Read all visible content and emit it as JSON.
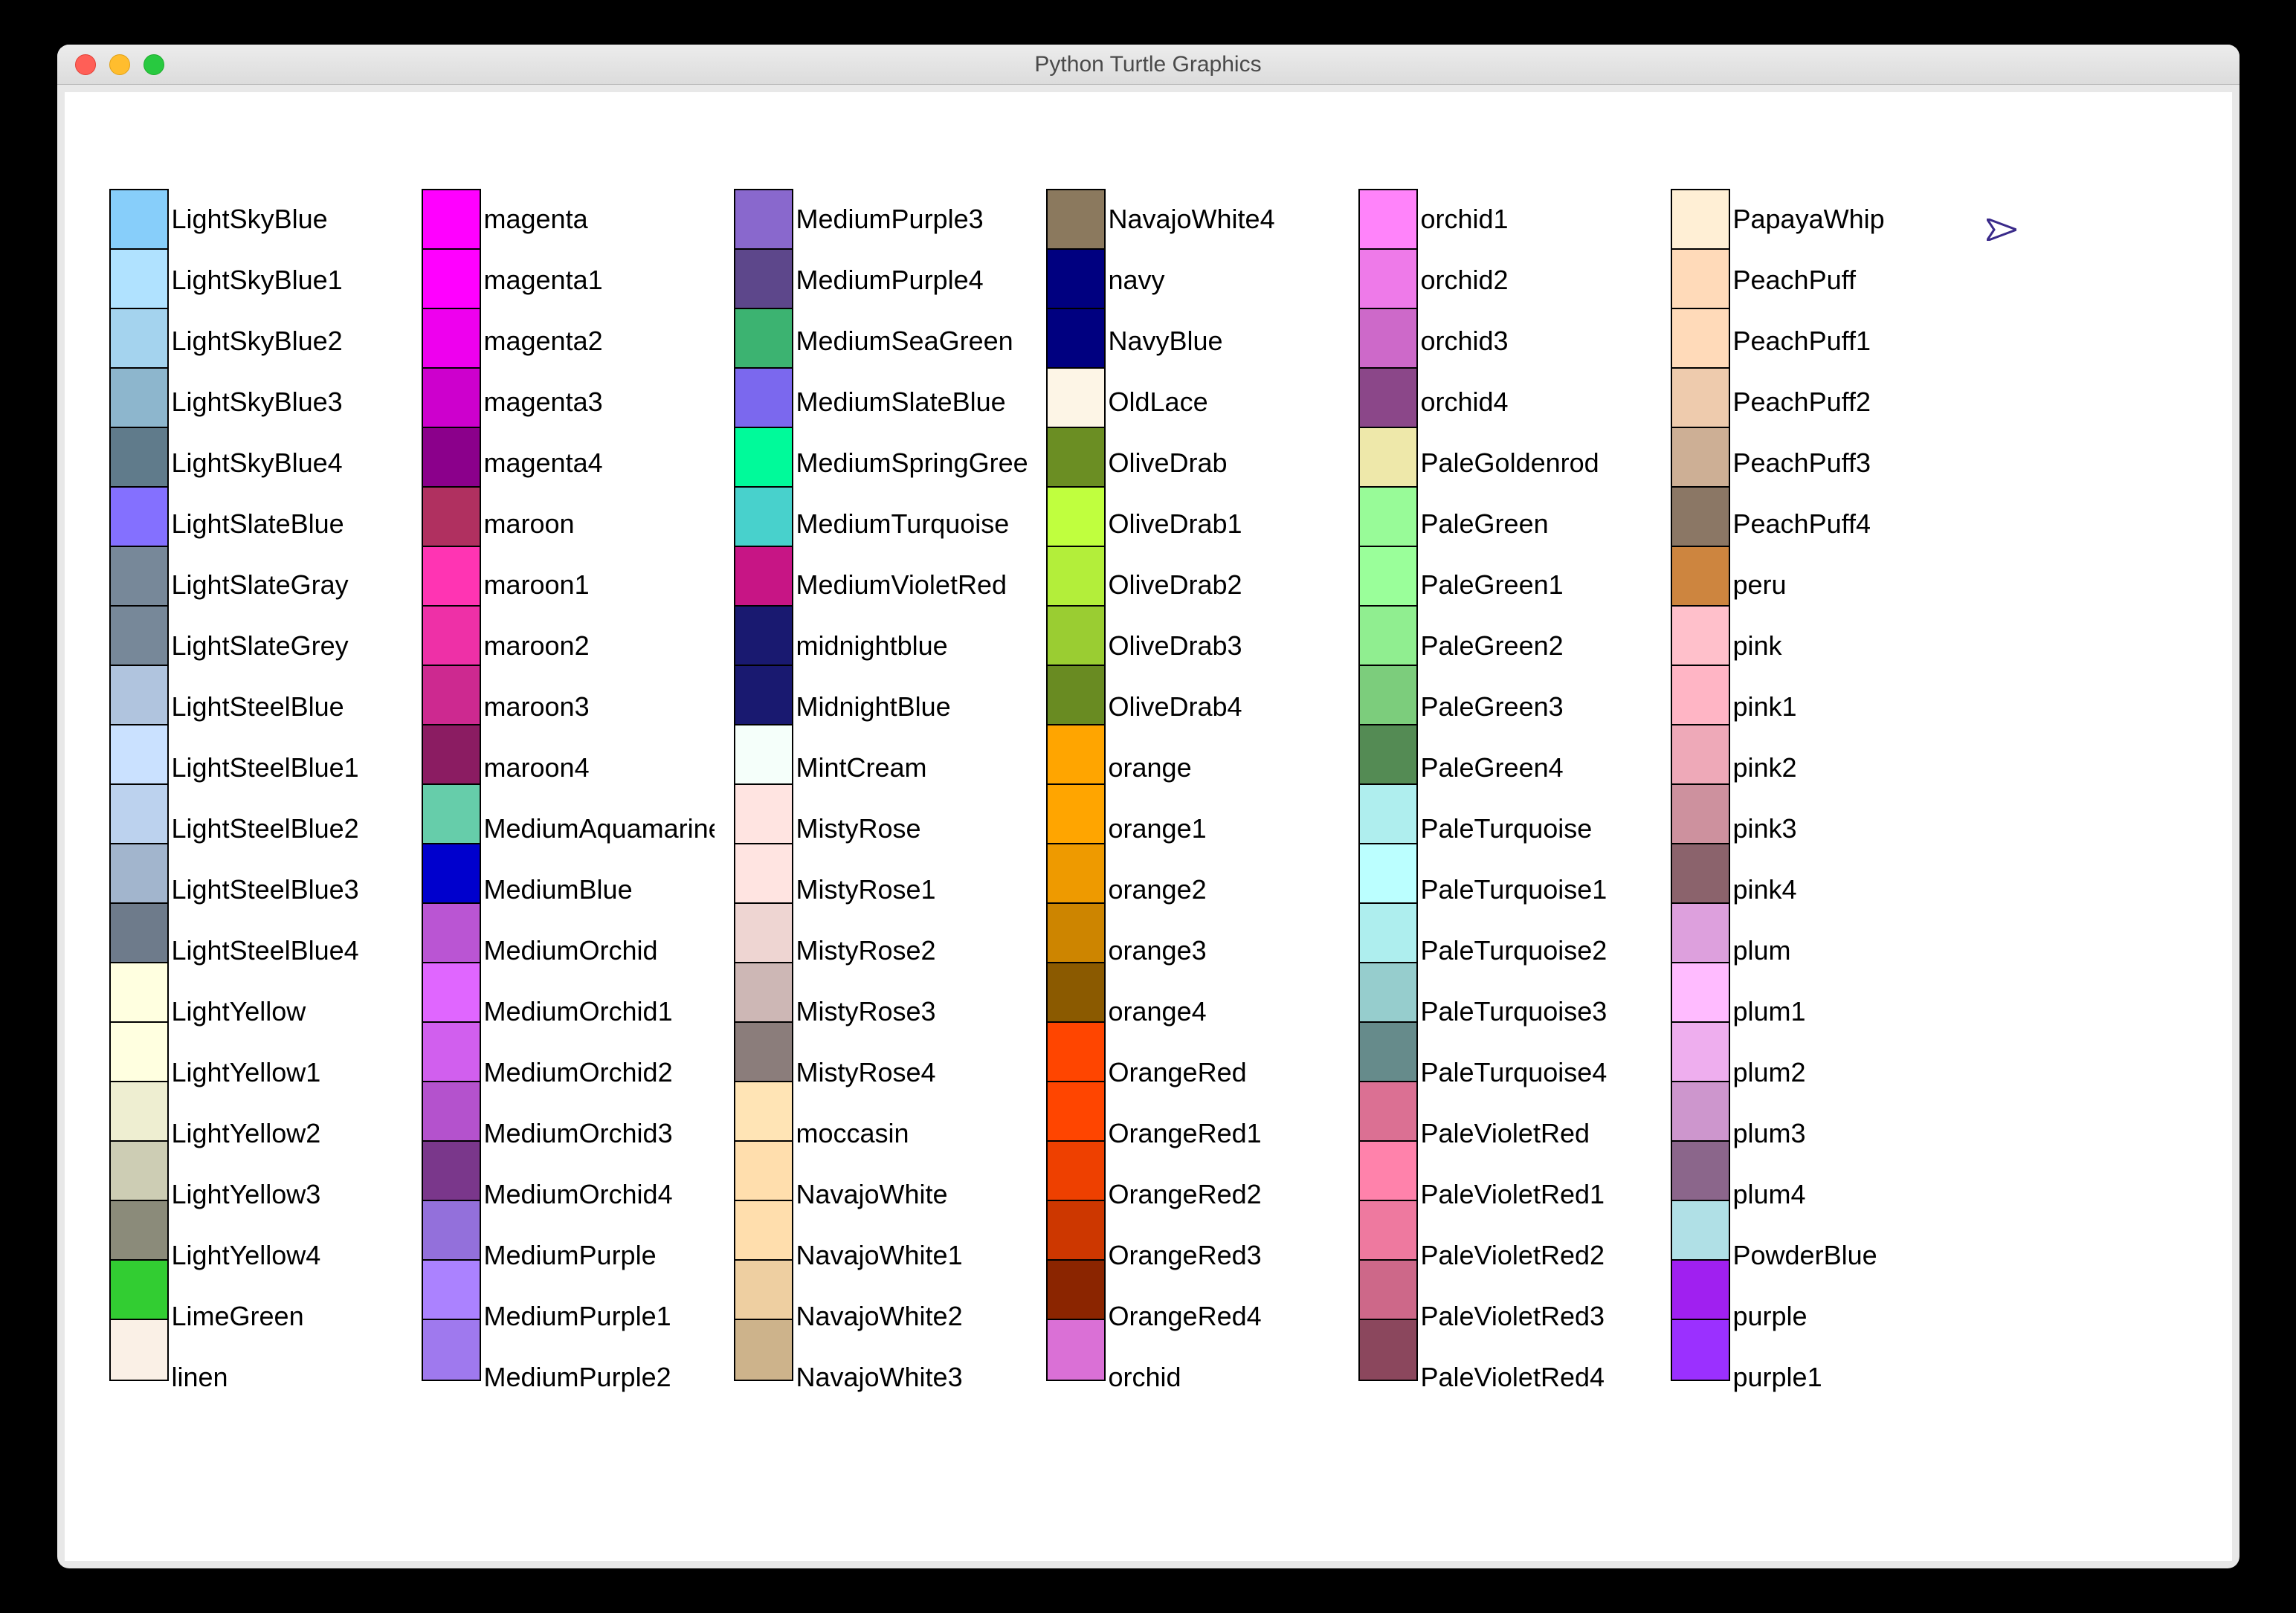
{
  "window": {
    "title": "Python Turtle Graphics"
  },
  "columns": [
    [
      {
        "name": "LightSkyBlue",
        "hex": "#87CEFA"
      },
      {
        "name": "LightSkyBlue1",
        "hex": "#B0E2FF"
      },
      {
        "name": "LightSkyBlue2",
        "hex": "#A4D3EE"
      },
      {
        "name": "LightSkyBlue3",
        "hex": "#8DB6CD"
      },
      {
        "name": "LightSkyBlue4",
        "hex": "#607B8B"
      },
      {
        "name": "LightSlateBlue",
        "hex": "#8470FF"
      },
      {
        "name": "LightSlateGray",
        "hex": "#778899"
      },
      {
        "name": "LightSlateGrey",
        "hex": "#778899"
      },
      {
        "name": "LightSteelBlue",
        "hex": "#B0C4DE"
      },
      {
        "name": "LightSteelBlue1",
        "hex": "#CAE1FF"
      },
      {
        "name": "LightSteelBlue2",
        "hex": "#BCD2EE"
      },
      {
        "name": "LightSteelBlue3",
        "hex": "#A2B5CD"
      },
      {
        "name": "LightSteelBlue4",
        "hex": "#6E7B8B"
      },
      {
        "name": "LightYellow",
        "hex": "#FFFFE0"
      },
      {
        "name": "LightYellow1",
        "hex": "#FFFFE0"
      },
      {
        "name": "LightYellow2",
        "hex": "#EEEED1"
      },
      {
        "name": "LightYellow3",
        "hex": "#CDCDB4"
      },
      {
        "name": "LightYellow4",
        "hex": "#8B8B7A"
      },
      {
        "name": "LimeGreen",
        "hex": "#32CD32"
      },
      {
        "name": "linen",
        "hex": "#FAF0E6"
      }
    ],
    [
      {
        "name": "magenta",
        "hex": "#FF00FF"
      },
      {
        "name": "magenta1",
        "hex": "#FF00FF"
      },
      {
        "name": "magenta2",
        "hex": "#EE00EE"
      },
      {
        "name": "magenta3",
        "hex": "#CD00CD"
      },
      {
        "name": "magenta4",
        "hex": "#8B008B"
      },
      {
        "name": "maroon",
        "hex": "#B03060"
      },
      {
        "name": "maroon1",
        "hex": "#FF34B3"
      },
      {
        "name": "maroon2",
        "hex": "#EE30A7"
      },
      {
        "name": "maroon3",
        "hex": "#CD2990"
      },
      {
        "name": "maroon4",
        "hex": "#8B1C62"
      },
      {
        "name": "MediumAquamarine",
        "hex": "#66CDAA"
      },
      {
        "name": "MediumBlue",
        "hex": "#0000CD"
      },
      {
        "name": "MediumOrchid",
        "hex": "#BA55D3"
      },
      {
        "name": "MediumOrchid1",
        "hex": "#E066FF"
      },
      {
        "name": "MediumOrchid2",
        "hex": "#D15FEE"
      },
      {
        "name": "MediumOrchid3",
        "hex": "#B452CD"
      },
      {
        "name": "MediumOrchid4",
        "hex": "#7A378B"
      },
      {
        "name": "MediumPurple",
        "hex": "#9370DB"
      },
      {
        "name": "MediumPurple1",
        "hex": "#AB82FF"
      },
      {
        "name": "MediumPurple2",
        "hex": "#9F79EE"
      }
    ],
    [
      {
        "name": "MediumPurple3",
        "hex": "#8968CD"
      },
      {
        "name": "MediumPurple4",
        "hex": "#5D478B"
      },
      {
        "name": "MediumSeaGreen",
        "hex": "#3CB371"
      },
      {
        "name": "MediumSlateBlue",
        "hex": "#7B68EE"
      },
      {
        "name": "MediumSpringGreen",
        "hex": "#00FA9A"
      },
      {
        "name": "MediumTurquoise",
        "hex": "#48D1CC"
      },
      {
        "name": "MediumVioletRed",
        "hex": "#C71585"
      },
      {
        "name": "midnightblue",
        "hex": "#191970"
      },
      {
        "name": "MidnightBlue",
        "hex": "#191970"
      },
      {
        "name": "MintCream",
        "hex": "#F5FFFA"
      },
      {
        "name": "MistyRose",
        "hex": "#FFE4E1"
      },
      {
        "name": "MistyRose1",
        "hex": "#FFE4E1"
      },
      {
        "name": "MistyRose2",
        "hex": "#EED5D2"
      },
      {
        "name": "MistyRose3",
        "hex": "#CDB7B5"
      },
      {
        "name": "MistyRose4",
        "hex": "#8B7D7B"
      },
      {
        "name": "moccasin",
        "hex": "#FFE4B5"
      },
      {
        "name": "NavajoWhite",
        "hex": "#FFDEAD"
      },
      {
        "name": "NavajoWhite1",
        "hex": "#FFDEAD"
      },
      {
        "name": "NavajoWhite2",
        "hex": "#EECFA1"
      },
      {
        "name": "NavajoWhite3",
        "hex": "#CDB38B"
      }
    ],
    [
      {
        "name": "NavajoWhite4",
        "hex": "#8B795E"
      },
      {
        "name": "navy",
        "hex": "#000080"
      },
      {
        "name": "NavyBlue",
        "hex": "#000080"
      },
      {
        "name": "OldLace",
        "hex": "#FDF5E6"
      },
      {
        "name": "OliveDrab",
        "hex": "#6B8E23"
      },
      {
        "name": "OliveDrab1",
        "hex": "#C0FF3E"
      },
      {
        "name": "OliveDrab2",
        "hex": "#B3EE3A"
      },
      {
        "name": "OliveDrab3",
        "hex": "#9ACD32"
      },
      {
        "name": "OliveDrab4",
        "hex": "#698B22"
      },
      {
        "name": "orange",
        "hex": "#FFA500"
      },
      {
        "name": "orange1",
        "hex": "#FFA500"
      },
      {
        "name": "orange2",
        "hex": "#EE9A00"
      },
      {
        "name": "orange3",
        "hex": "#CD8500"
      },
      {
        "name": "orange4",
        "hex": "#8B5A00"
      },
      {
        "name": "OrangeRed",
        "hex": "#FF4500"
      },
      {
        "name": "OrangeRed1",
        "hex": "#FF4500"
      },
      {
        "name": "OrangeRed2",
        "hex": "#EE4000"
      },
      {
        "name": "OrangeRed3",
        "hex": "#CD3700"
      },
      {
        "name": "OrangeRed4",
        "hex": "#8B2500"
      },
      {
        "name": "orchid",
        "hex": "#DA70D6"
      }
    ],
    [
      {
        "name": "orchid1",
        "hex": "#FF83FA"
      },
      {
        "name": "orchid2",
        "hex": "#EE7AE9"
      },
      {
        "name": "orchid3",
        "hex": "#CD69C9"
      },
      {
        "name": "orchid4",
        "hex": "#8B4789"
      },
      {
        "name": "PaleGoldenrod",
        "hex": "#EEE8AA"
      },
      {
        "name": "PaleGreen",
        "hex": "#98FB98"
      },
      {
        "name": "PaleGreen1",
        "hex": "#9AFF9A"
      },
      {
        "name": "PaleGreen2",
        "hex": "#90EE90"
      },
      {
        "name": "PaleGreen3",
        "hex": "#7CCD7C"
      },
      {
        "name": "PaleGreen4",
        "hex": "#548B54"
      },
      {
        "name": "PaleTurquoise",
        "hex": "#AFEEEE"
      },
      {
        "name": "PaleTurquoise1",
        "hex": "#BBFFFF"
      },
      {
        "name": "PaleTurquoise2",
        "hex": "#AEEEEE"
      },
      {
        "name": "PaleTurquoise3",
        "hex": "#96CDCD"
      },
      {
        "name": "PaleTurquoise4",
        "hex": "#668B8B"
      },
      {
        "name": "PaleVioletRed",
        "hex": "#DB7093"
      },
      {
        "name": "PaleVioletRed1",
        "hex": "#FF82AB"
      },
      {
        "name": "PaleVioletRed2",
        "hex": "#EE799F"
      },
      {
        "name": "PaleVioletRed3",
        "hex": "#CD6889"
      },
      {
        "name": "PaleVioletRed4",
        "hex": "#8B475D"
      }
    ],
    [
      {
        "name": "PapayaWhip",
        "hex": "#FFEFD5"
      },
      {
        "name": "PeachPuff",
        "hex": "#FFDAB9"
      },
      {
        "name": "PeachPuff1",
        "hex": "#FFDAB9"
      },
      {
        "name": "PeachPuff2",
        "hex": "#EECBAD"
      },
      {
        "name": "PeachPuff3",
        "hex": "#CDAF95"
      },
      {
        "name": "PeachPuff4",
        "hex": "#8B7765"
      },
      {
        "name": "peru",
        "hex": "#CD853F"
      },
      {
        "name": "pink",
        "hex": "#FFC0CB"
      },
      {
        "name": "pink1",
        "hex": "#FFB5C5"
      },
      {
        "name": "pink2",
        "hex": "#EEA9B8"
      },
      {
        "name": "pink3",
        "hex": "#CD919E"
      },
      {
        "name": "pink4",
        "hex": "#8B636C"
      },
      {
        "name": "plum",
        "hex": "#DDA0DD"
      },
      {
        "name": "plum1",
        "hex": "#FFBBFF"
      },
      {
        "name": "plum2",
        "hex": "#EEAEEE"
      },
      {
        "name": "plum3",
        "hex": "#CD96CD"
      },
      {
        "name": "plum4",
        "hex": "#8B668B"
      },
      {
        "name": "PowderBlue",
        "hex": "#B0E0E6"
      },
      {
        "name": "purple",
        "hex": "#A020F0"
      },
      {
        "name": "purple1",
        "hex": "#9B30FF"
      }
    ]
  ]
}
